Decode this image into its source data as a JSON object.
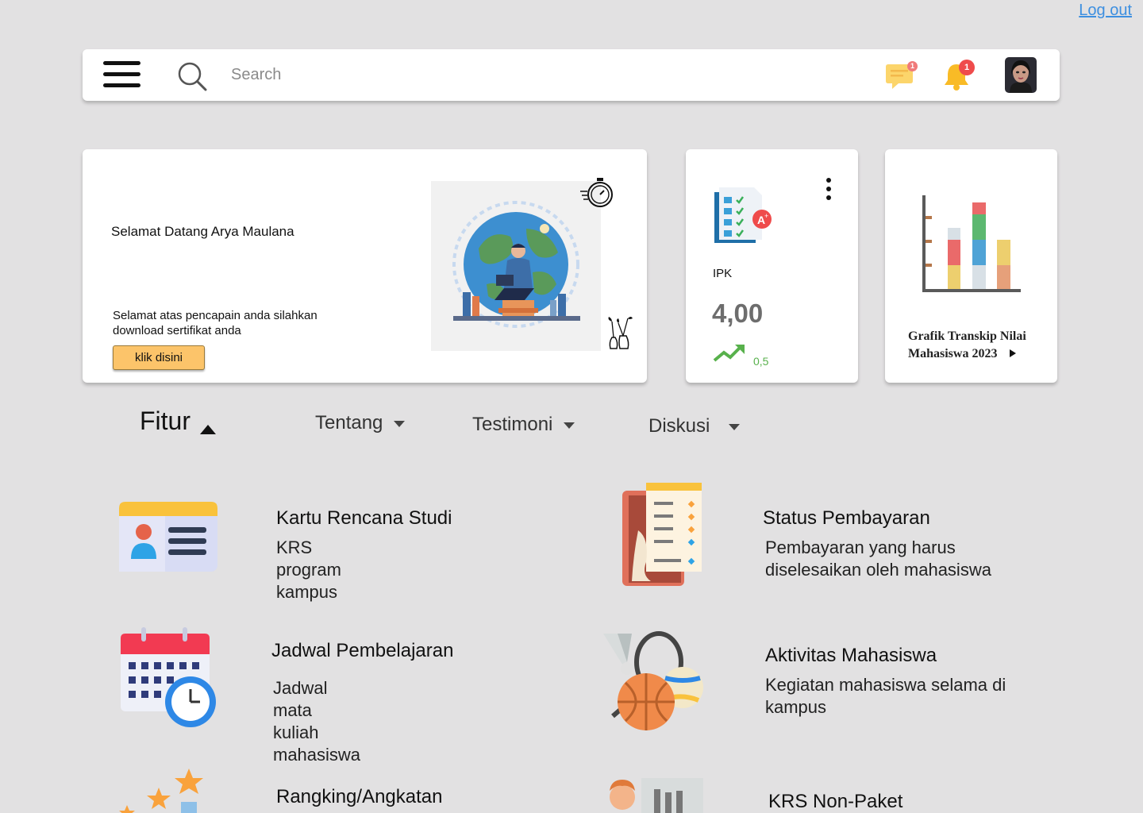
{
  "header": {
    "logout_label": "Log out",
    "search_placeholder": "Search",
    "messages_count": "1",
    "notifications_count": "1"
  },
  "welcome": {
    "title": "Selamat Datang Arya Maulana",
    "message": "Selamat atas pencapain anda silahkan download sertifikat anda",
    "button_label": "klik disini"
  },
  "ipk": {
    "label": "IPK",
    "value": "4,00",
    "delta": "0,5"
  },
  "transcript": {
    "caption_line1": "Grafik Transkip Nilai",
    "caption_line2": "Mahasiswa 2023"
  },
  "tabs": [
    {
      "label": "Fitur",
      "active": true
    },
    {
      "label": "Tentang",
      "active": false
    },
    {
      "label": "Testimoni",
      "active": false
    },
    {
      "label": "Diskusi",
      "active": false
    }
  ],
  "features": [
    {
      "title": "Kartu Rencana Studi",
      "desc": "KRS program kampus"
    },
    {
      "title": "Status Pembayaran",
      "desc": "Pembayaran yang harus diselesaikan oleh mahasiswa"
    },
    {
      "title": "Jadwal Pembelajaran",
      "desc": "Jadwal mata kuliah mahasiswa"
    },
    {
      "title": "Aktivitas Mahasiswa",
      "desc": "Kegiatan mahasiswa selama di kampus"
    },
    {
      "title": "Rangking/Angkatan",
      "desc": ""
    },
    {
      "title": "KRS Non-Paket",
      "desc": ""
    }
  ],
  "colors": {
    "accent_button": "#fcc46a",
    "link": "#3d8fe0",
    "badge": "#ef4b4b",
    "positive": "#58b14c"
  }
}
